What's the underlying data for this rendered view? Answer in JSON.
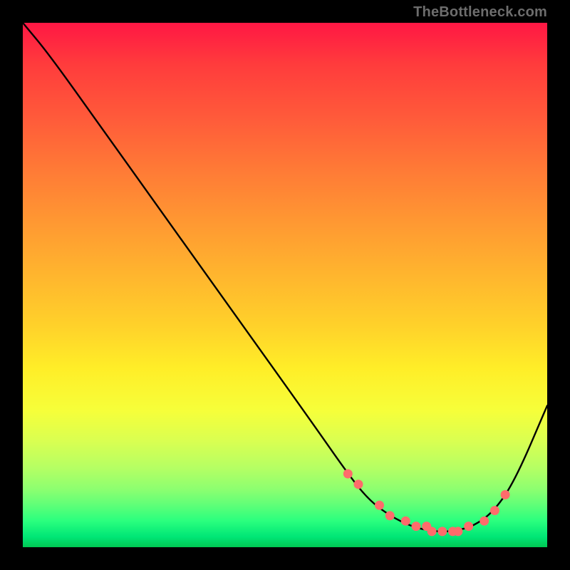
{
  "watermark": "TheBottleneck.com",
  "chart_data": {
    "type": "line",
    "title": "",
    "xlabel": "",
    "ylabel": "",
    "xlim": [
      0,
      100
    ],
    "ylim": [
      0,
      100
    ],
    "grid": false,
    "legend": false,
    "series": [
      {
        "name": "curve",
        "x": [
          0,
          5,
          15,
          25,
          35,
          45,
          55,
          62,
          66,
          70,
          74,
          78,
          82,
          86,
          90,
          94,
          100
        ],
        "y": [
          100,
          94,
          80,
          66,
          52,
          38,
          24,
          14,
          9,
          6,
          4,
          3,
          3,
          4,
          7,
          13,
          27
        ]
      }
    ],
    "markers": {
      "name": "highlight-points",
      "color": "#ff6b6b",
      "x": [
        62,
        64,
        68,
        70,
        73,
        75,
        77,
        78,
        80,
        82,
        83,
        85,
        88,
        90,
        92
      ],
      "y": [
        14,
        12,
        8,
        6,
        5,
        4,
        4,
        3,
        3,
        3,
        3,
        4,
        5,
        7,
        10
      ]
    },
    "background_gradient": {
      "top": "#ff1744",
      "bottom": "#00c853"
    }
  }
}
